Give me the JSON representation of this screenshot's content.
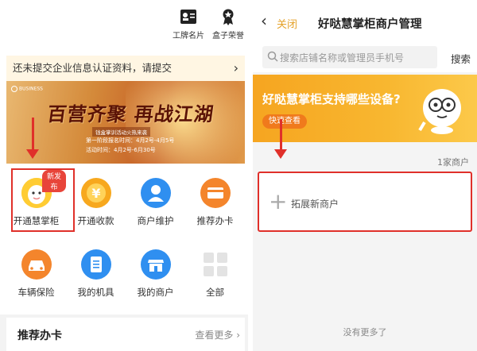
{
  "left": {
    "top_actions": [
      {
        "label": "工牌名片",
        "icon": "id-card-icon"
      },
      {
        "label": "盒子荣誉",
        "icon": "medal-icon"
      }
    ],
    "notice": {
      "text": "还未提交企业信息认证资料，请提交",
      "icon": "chevron-right-icon"
    },
    "banner": {
      "headline": "百营齐聚 再战江湖",
      "logo_text": "BUSINESS",
      "sub": "钱盒掌训活动火热来袭",
      "line1": "第一阶段报名时间：4月2号-4月5号",
      "line2": "活动时间：4月2号-6月30号"
    },
    "grid": [
      {
        "label": "开通慧掌柜",
        "icon": "smart-cabinet-icon",
        "badge": "新发布"
      },
      {
        "label": "开通收款",
        "icon": "yen-coin-icon"
      },
      {
        "label": "商户维护",
        "icon": "person-icon"
      },
      {
        "label": "推荐办卡",
        "icon": "card-icon"
      },
      {
        "label": "车辆保险",
        "icon": "car-icon"
      },
      {
        "label": "我的机具",
        "icon": "clipboard-icon"
      },
      {
        "label": "我的商户",
        "icon": "shop-icon"
      },
      {
        "label": "全部",
        "icon": "grid-icon"
      }
    ],
    "bottom": {
      "title": "推荐办卡",
      "more": "查看更多"
    }
  },
  "right": {
    "nav": {
      "close": "关闭",
      "title": "好哒慧掌柜商户管理"
    },
    "search": {
      "placeholder": "搜索店铺名称或管理员手机号",
      "button": "搜索"
    },
    "promo": {
      "text": "好哒慧掌柜支持哪些设备?",
      "button": "快速查看"
    },
    "count": "1家商户",
    "card": {
      "label": "拓展新商户"
    },
    "footer": "没有更多了"
  },
  "colors": {
    "accent": "#f6a520",
    "highlight": "#e0302a",
    "link": "#e5a22a"
  }
}
